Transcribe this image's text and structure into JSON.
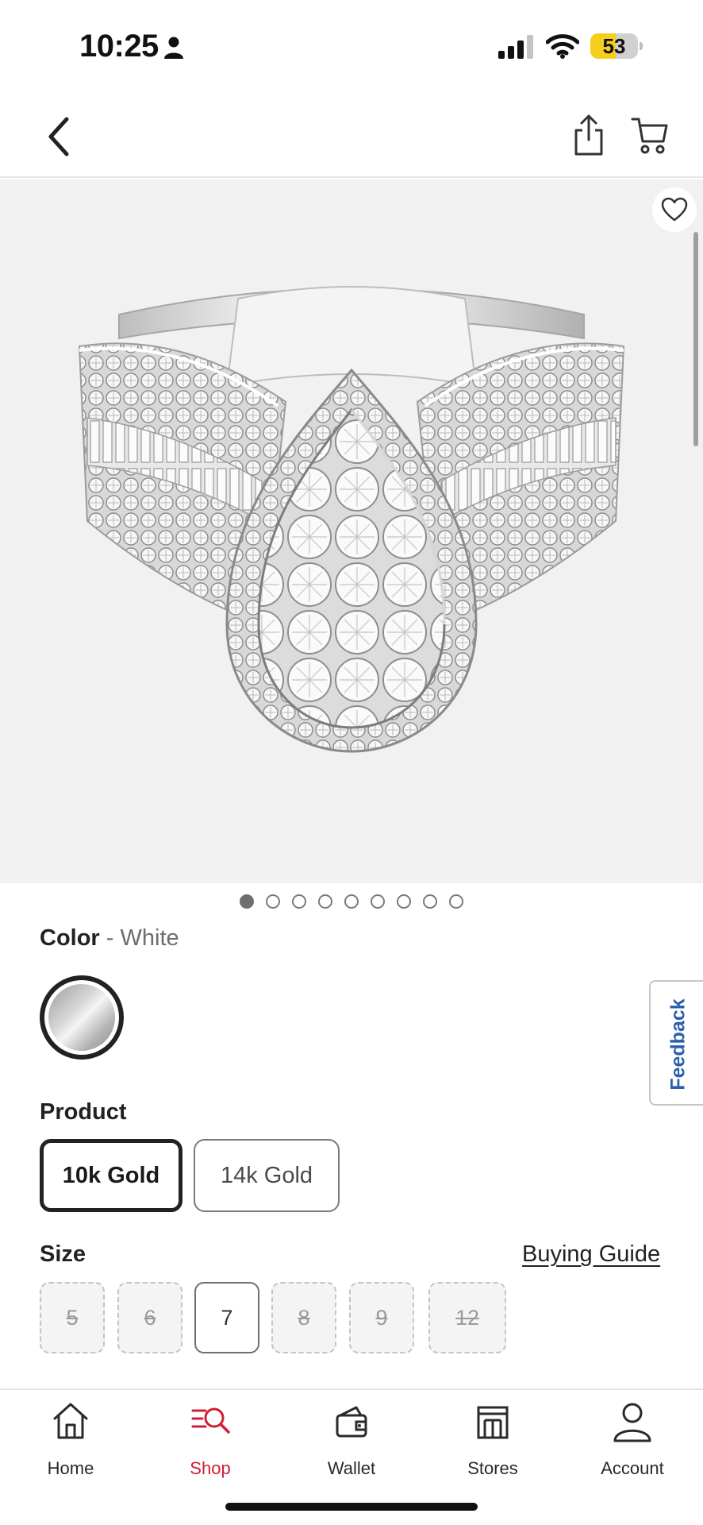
{
  "status_bar": {
    "time": "10:25",
    "battery_level": "53",
    "battery_fraction": 0.53,
    "icons": [
      "person-icon",
      "signal-icon",
      "wifi-icon",
      "battery-icon"
    ]
  },
  "header": {
    "icons": [
      "chevron-left-icon",
      "share-icon",
      "cart-icon"
    ]
  },
  "gallery": {
    "image_count": 9,
    "active_index": 0,
    "wishlist_icon": "heart-outline-icon"
  },
  "color": {
    "label": "Color",
    "separator": " - ",
    "selected": "White",
    "swatch_color": "#c8c8c8"
  },
  "feedback": {
    "label": "Feedback",
    "color": "#2b5eac"
  },
  "product": {
    "label": "Product",
    "options": [
      {
        "label": "10k Gold",
        "selected": true
      },
      {
        "label": "14k Gold",
        "selected": false
      }
    ]
  },
  "size": {
    "label": "Size",
    "guide_link": "Buying Guide",
    "options": [
      {
        "label": "5",
        "available": false
      },
      {
        "label": "6",
        "available": false
      },
      {
        "label": "7",
        "available": true,
        "selected": true
      },
      {
        "label": "8",
        "available": false
      },
      {
        "label": "9",
        "available": false
      },
      {
        "label": "12",
        "available": false
      }
    ]
  },
  "tabs": [
    {
      "label": "Home",
      "icon": "home-icon",
      "active": false
    },
    {
      "label": "Shop",
      "icon": "shop-search-icon",
      "active": true
    },
    {
      "label": "Wallet",
      "icon": "wallet-icon",
      "active": false
    },
    {
      "label": "Stores",
      "icon": "store-icon",
      "active": false
    },
    {
      "label": "Account",
      "icon": "account-icon",
      "active": false
    }
  ],
  "colors": {
    "accent_red": "#cf1f36",
    "feedback_blue": "#2b5eac",
    "battery_yellow": "#f5cf1b"
  }
}
